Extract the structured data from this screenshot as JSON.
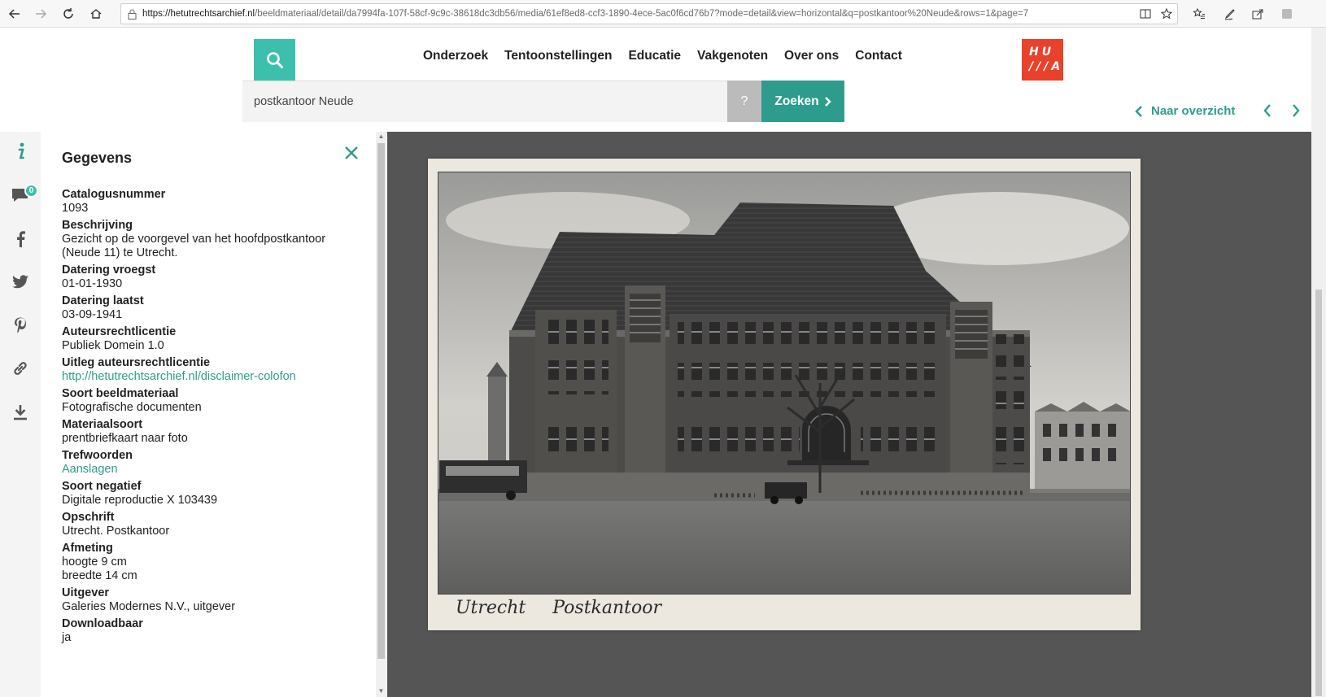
{
  "browser": {
    "url_host": "https://hetutrechtsarchief.nl",
    "url_path": "/beeldmateriaal/detail/da7994fa-107f-58cf-9c9c-38618dc3db56/media/61ef8ed8-ccf3-1890-4ece-5ac0f6cd76b7?mode=detail&view=horizontal&q=postkantoor%20Neude&rows=1&page=7"
  },
  "nav": {
    "items": [
      "Onderzoek",
      "Tentoonstellingen",
      "Educatie",
      "Vakgenoten",
      "Over ons",
      "Contact"
    ]
  },
  "logo": {
    "line1": "HU",
    "line2": "///A"
  },
  "search": {
    "value": "postkantoor Neude",
    "help_label": "?",
    "submit_label": "Zoeken"
  },
  "overview": {
    "label": "Naar overzicht"
  },
  "rail": {
    "comment_count": "0"
  },
  "panel": {
    "title": "Gegevens",
    "fields": [
      {
        "label": "Catalogusnummer",
        "values": [
          "1093"
        ]
      },
      {
        "label": "Beschrijving",
        "values": [
          "Gezicht op de voorgevel van het hoofdpostkantoor",
          "(Neude 11) te Utrecht."
        ]
      },
      {
        "label": "Datering vroegst",
        "values": [
          "01-01-1930"
        ]
      },
      {
        "label": "Datering laatst",
        "values": [
          "03-09-1941"
        ]
      },
      {
        "label": "Auteursrechtlicentie",
        "values": [
          "Publiek Domein 1.0"
        ]
      },
      {
        "label": "Uitleg auteursrechtlicentie",
        "values": [
          "http://hetutrechtsarchief.nl/disclaimer-colofon"
        ],
        "link": true
      },
      {
        "label": "Soort beeldmateriaal",
        "values": [
          "Fotografische documenten"
        ]
      },
      {
        "label": "Materiaalsoort",
        "values": [
          "prentbriefkaart naar foto"
        ]
      },
      {
        "label": "Trefwoorden",
        "values": [
          "Aanslagen"
        ],
        "link": true
      },
      {
        "label": "Soort negatief",
        "values": [
          "Digitale reproductie X 103439"
        ]
      },
      {
        "label": "Opschrift",
        "values": [
          "Utrecht. Postkantoor"
        ]
      },
      {
        "label": "Afmeting",
        "values": [
          "hoogte 9 cm",
          "breedte 14 cm"
        ]
      },
      {
        "label": "Uitgever",
        "values": [
          "Galeries Modernes N.V., uitgever"
        ]
      },
      {
        "label": "Downloadbaar",
        "values": [
          "ja"
        ]
      }
    ]
  },
  "postcard": {
    "caption": "Utrecht Postkantoor"
  },
  "colors": {
    "accent": "#3dbfae",
    "accent_dark": "#2e9c8c",
    "logo_red": "#e8412c",
    "viewer_bg": "#555555"
  }
}
